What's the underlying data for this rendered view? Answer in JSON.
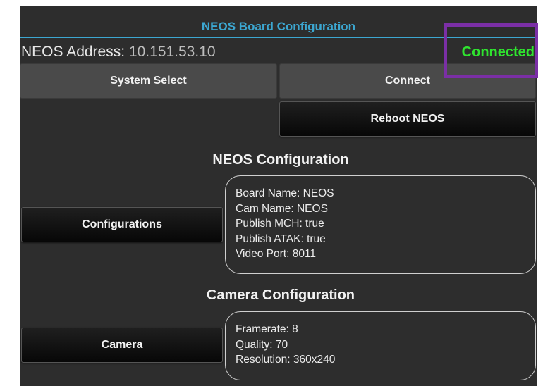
{
  "header": {
    "title": "NEOS Board Configuration"
  },
  "connection": {
    "address_label": "NEOS Address:",
    "address_value": "10.151.53.10",
    "status": "Connected",
    "status_color": "#2fe32f"
  },
  "buttons": {
    "system_select": "System Select",
    "connect": "Connect",
    "reboot": "Reboot NEOS",
    "configurations": "Configurations",
    "camera": "Camera"
  },
  "neos_config": {
    "heading": "NEOS Configuration",
    "lines": [
      "Board Name: NEOS",
      "Cam Name: NEOS",
      "Publish MCH: true",
      "Publish ATAK: true",
      "Video Port: 8011"
    ]
  },
  "camera_config": {
    "heading": "Camera Configuration",
    "lines": [
      "Framerate: 8",
      "Quality: 70",
      "Resolution: 360x240"
    ]
  },
  "colors": {
    "accent": "#3ca7d1",
    "background": "#2d2d2d",
    "highlight": "#7b2fa6"
  }
}
